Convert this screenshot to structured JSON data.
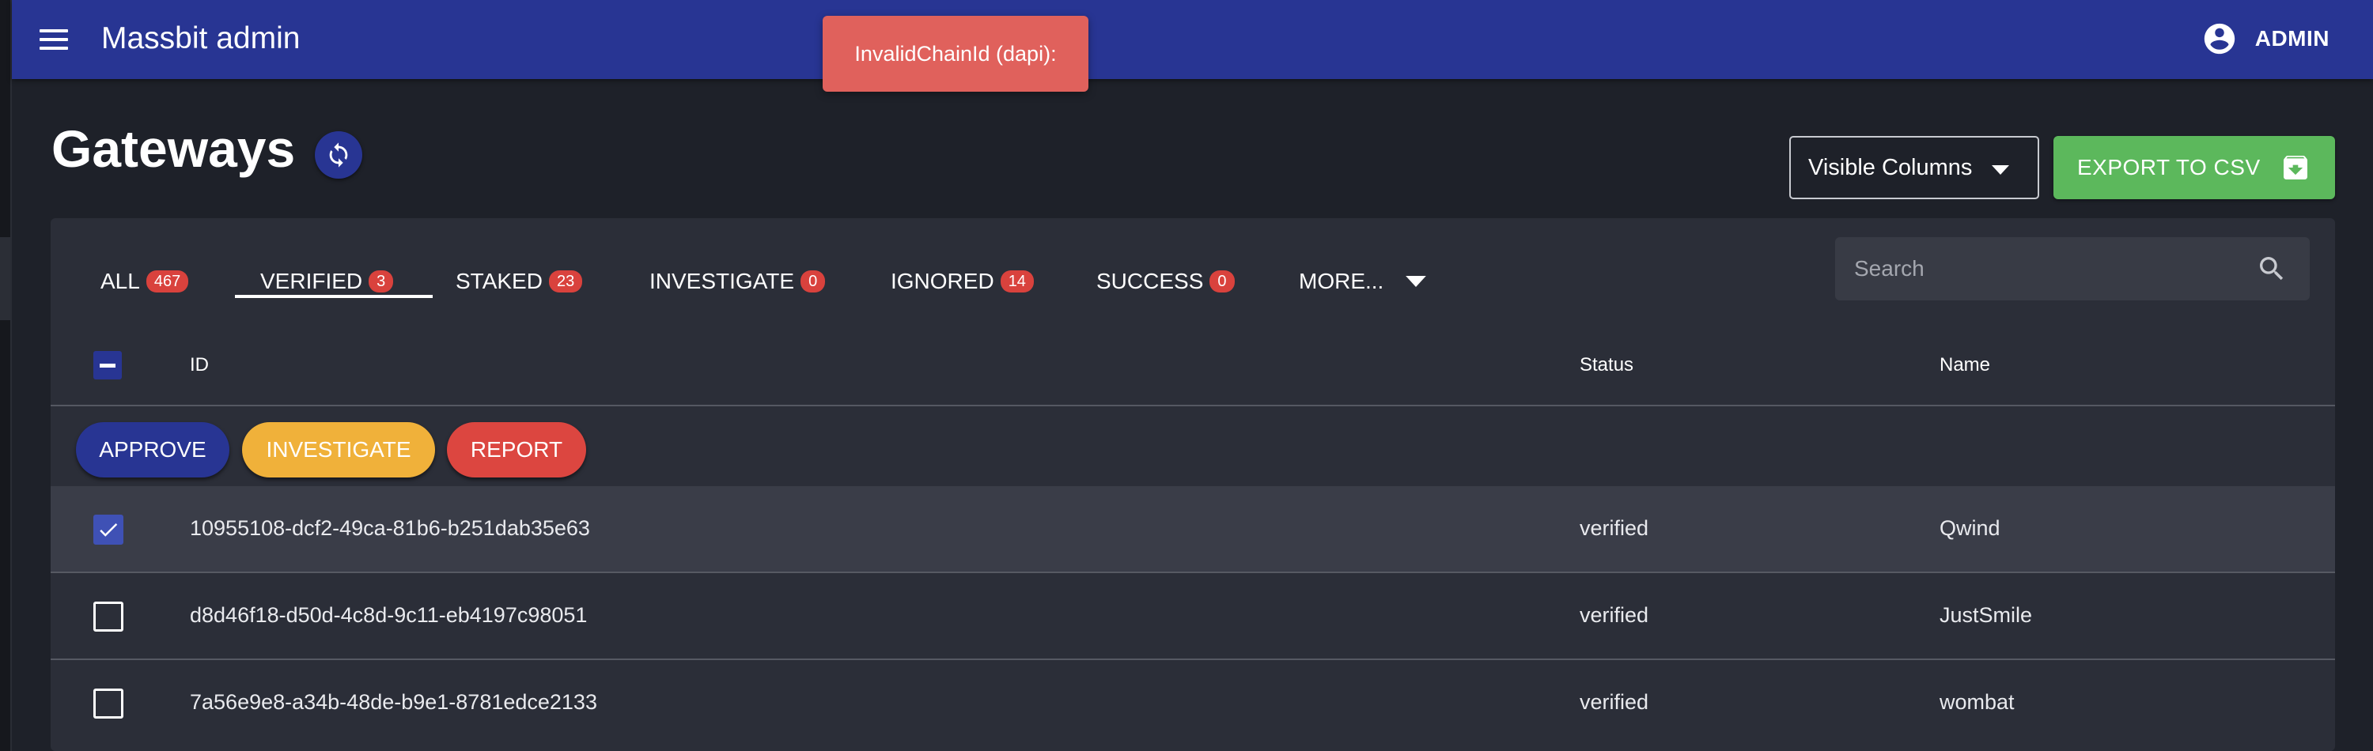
{
  "app": {
    "title": "Massbit admin",
    "user": "ADMIN"
  },
  "toast": {
    "message": "InvalidChainId (dapi):"
  },
  "page": {
    "title": "Gateways"
  },
  "toolbar": {
    "visible_columns_label": "Visible Columns",
    "export_label": "EXPORT TO CSV"
  },
  "tabs": [
    {
      "label": "ALL",
      "count": "467"
    },
    {
      "label": "VERIFIED",
      "count": "3",
      "active": true
    },
    {
      "label": "STAKED",
      "count": "23"
    },
    {
      "label": "INVESTIGATE",
      "count": "0"
    },
    {
      "label": "IGNORED",
      "count": "14"
    },
    {
      "label": "SUCCESS",
      "count": "0"
    },
    {
      "label": "MORE..."
    }
  ],
  "search": {
    "placeholder": "Search"
  },
  "table": {
    "columns": [
      "ID",
      "Status",
      "Name"
    ],
    "actions": {
      "approve": "APPROVE",
      "investigate": "INVESTIGATE",
      "report": "REPORT"
    },
    "rows": [
      {
        "id": "10955108-dcf2-49ca-81b6-b251dab35e63",
        "status": "verified",
        "name": "Qwind",
        "selected": true
      },
      {
        "id": "d8d46f18-d50d-4c8d-9c11-eb4197c98051",
        "status": "verified",
        "name": "JustSmile",
        "selected": false
      },
      {
        "id": "7a56e9e8-a34b-48de-b9e1-8781edce2133",
        "status": "verified",
        "name": "wombat",
        "selected": false
      }
    ]
  },
  "colors": {
    "appbar": "#283593",
    "background": "#1e2129",
    "panel": "#2b2e38",
    "toast": "#e0615c",
    "export": "#5cb85c",
    "badge": "#d9423d",
    "approve": "#283593",
    "investigate": "#f0b13a",
    "report": "#dc4640"
  },
  "icons": [
    "menu-icon",
    "account-circle-icon",
    "refresh-icon",
    "caret-down-icon",
    "archive-download-icon",
    "search-icon",
    "check-icon"
  ]
}
